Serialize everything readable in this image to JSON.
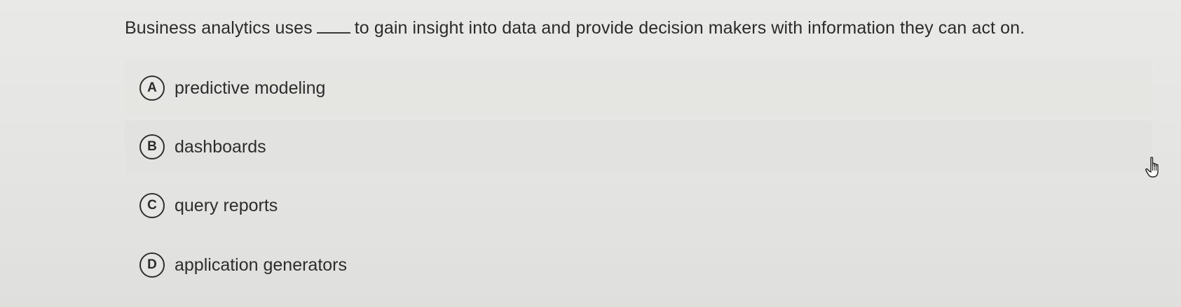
{
  "question": {
    "text_before": "Business analytics uses",
    "text_after": "to gain insight into data and provide decision makers with information they can act on."
  },
  "options": [
    {
      "letter": "A",
      "text": "predictive modeling"
    },
    {
      "letter": "B",
      "text": "dashboards"
    },
    {
      "letter": "C",
      "text": "query reports"
    },
    {
      "letter": "D",
      "text": "application generators"
    }
  ],
  "icons": {
    "cursor": "hand-pointer-icon"
  },
  "colors": {
    "background": "#e5e5e3",
    "text": "#2b2b2b",
    "circle_border": "#2f2f2f"
  }
}
